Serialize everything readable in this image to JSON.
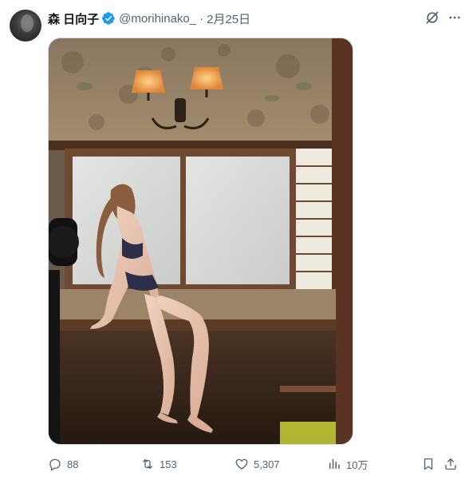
{
  "author": {
    "display_name": "森 日向子",
    "handle": "@morihinako_",
    "separator": "·",
    "date": "2月25日",
    "verified": true
  },
  "media": {
    "alt": "photo"
  },
  "actions": {
    "replies": "88",
    "reposts": "153",
    "likes": "5,307",
    "views": "10万"
  },
  "icons": {
    "verified_color": "#1d9bf0",
    "muted_color": "#536471"
  }
}
